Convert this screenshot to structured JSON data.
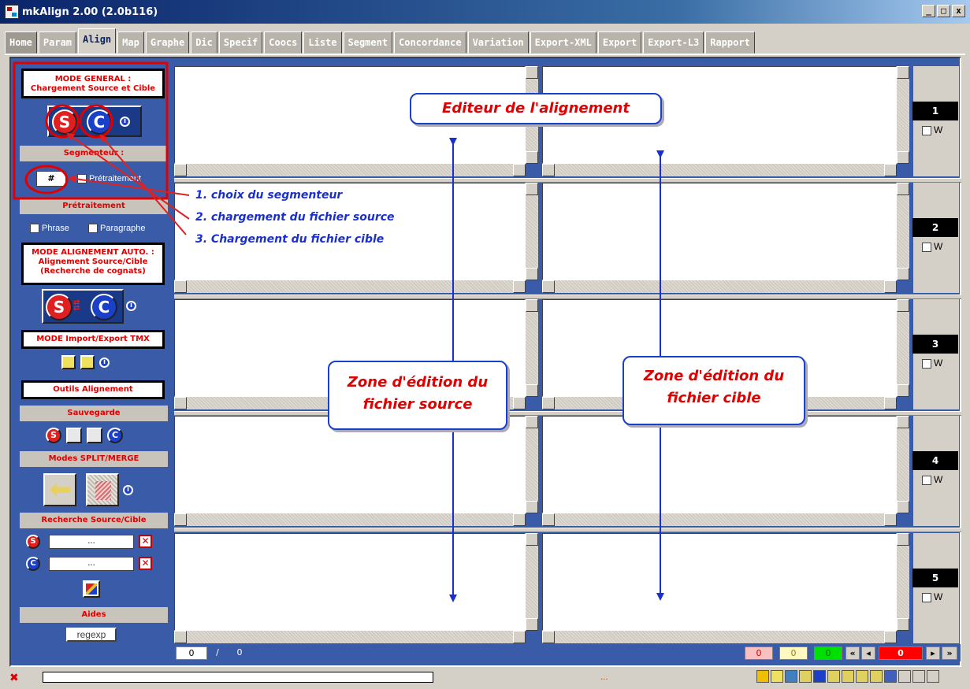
{
  "window": {
    "title": "mkAlign 2.00 (2.0b116)",
    "min": "_",
    "max": "□",
    "close": "x"
  },
  "tabs": [
    {
      "label": "Home"
    },
    {
      "label": "Param"
    },
    {
      "label": "Align",
      "active": true
    },
    {
      "label": "Map"
    },
    {
      "label": "Graphe"
    },
    {
      "label": "Dic"
    },
    {
      "label": "Specif"
    },
    {
      "label": "Coocs"
    },
    {
      "label": "Liste"
    },
    {
      "label": "Segment"
    },
    {
      "label": "Concordance"
    },
    {
      "label": "Variation"
    },
    {
      "label": "Export-XML"
    },
    {
      "label": "Export"
    },
    {
      "label": "Export-L3"
    },
    {
      "label": "Rapport"
    }
  ],
  "left_panel": {
    "mode_general_line1": "MODE GENERAL :",
    "mode_general_line2": "Chargement Source et Cible",
    "source_icon": "S",
    "target_icon": "C",
    "segmenteur_header": "Segmenteur :",
    "segmenteur_value": "#",
    "pretraitement_check": "Prétraitement",
    "pretraitement_header": "Prétraitement",
    "phrase_label": "Phrase",
    "paragraphe_label": "Paragraphe",
    "mode_auto_line1": "MODE ALIGNEMENT AUTO. :",
    "mode_auto_line2": "Alignement Source/Cible",
    "mode_auto_line3": "(Recherche de cognats)",
    "mode_tmx": "MODE Import/Export TMX",
    "outils": "Outils Alignement",
    "sauvegarde_header": "Sauvegarde",
    "split_merge_header": "Modes SPLIT/MERGE",
    "recherche_header": "Recherche Source/Cible",
    "search_source_value": "...",
    "search_target_value": "...",
    "aides_header": "Aides",
    "regexp_label": "regexp"
  },
  "rows": [
    {
      "number": "1",
      "w_label": "W"
    },
    {
      "number": "2",
      "w_label": "W"
    },
    {
      "number": "3",
      "w_label": "W"
    },
    {
      "number": "4",
      "w_label": "W"
    },
    {
      "number": "5",
      "w_label": "W"
    }
  ],
  "navbar": {
    "current": "0",
    "separator": "/",
    "total": "0",
    "count_red": "0",
    "count_yellow": "0",
    "count_green": "0",
    "position": "0",
    "first": "«",
    "prev": "◂",
    "next": "▸",
    "last": "»"
  },
  "statusbar": {
    "middle_text": "..."
  },
  "annotations": {
    "editor_title": "Editeur de l'alignement",
    "step1": "1. choix du segmenteur",
    "step2": "2. chargement du fichier source",
    "step3": "3. Chargement du fichier cible",
    "source_zone_line1": "Zone d'édition du",
    "source_zone_line2": "fichier source",
    "target_zone_line1": "Zone d'édition du",
    "target_zone_line2": "fichier cible"
  },
  "colors": {
    "panel_blue": "#3a5ca8",
    "annotation_blue": "#1a2fd0",
    "annotation_red": "#e00000",
    "titlebar": "#0a246a"
  }
}
